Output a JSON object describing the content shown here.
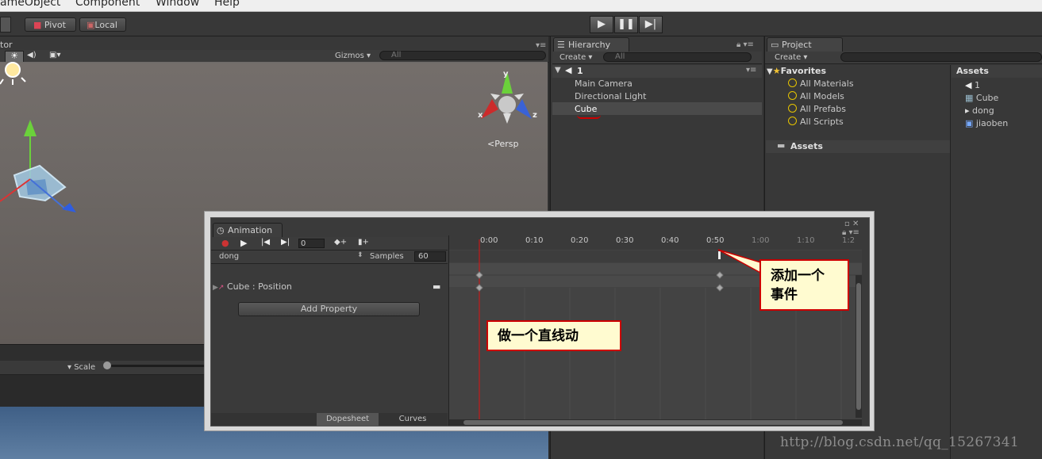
{
  "menu": {
    "items": [
      "ameObject",
      "Component",
      "Window",
      "Help"
    ]
  },
  "toolbar": {
    "pivot_label": "Pivot",
    "local_label": "Local",
    "play_icon": "play-icon",
    "pause_icon": "pause-icon",
    "step_icon": "step-icon"
  },
  "scene": {
    "title_partial": "tor",
    "gizmos_label": "Gizmos",
    "search_placeholder": "All",
    "persp_label": "Persp",
    "axis": {
      "y": "y",
      "x": "x",
      "z": "z"
    },
    "scale_label": "Scale"
  },
  "hierarchy": {
    "tab": "Hierarchy",
    "create": "Create",
    "search_placeholder": "All",
    "scene_name": "1",
    "items": [
      "Main Camera",
      "Directional Light",
      "Cube"
    ],
    "selected": "Cube"
  },
  "project": {
    "tab": "Project",
    "create": "Create",
    "favorites": {
      "label": "Favorites",
      "items": [
        "All Materials",
        "All Models",
        "All Prefabs",
        "All Scripts"
      ]
    },
    "assets_folder": "Assets",
    "assets_header": "Assets",
    "assets": [
      "1",
      "Cube",
      "dong",
      "jiaoben"
    ]
  },
  "animation": {
    "tab": "Animation",
    "frame": "0",
    "clip": "dong",
    "samples_label": "Samples",
    "samples": "60",
    "property": "Cube : Position",
    "add_property": "Add Property",
    "timeline": [
      "0:00",
      "0:10",
      "0:20",
      "0:30",
      "0:40",
      "0:50",
      "1:00",
      "1:10",
      "1:2"
    ],
    "dopesheet": "Dopesheet",
    "curves": "Curves"
  },
  "callouts": {
    "event": "添加一个\n事件",
    "linear": "做一个直线动"
  },
  "watermark": "http://blog.csdn.net/qq_15267341",
  "colors": {
    "accent_red": "#cc0000",
    "callout_bg": "#fffbd0",
    "selection": "#4a4a4a"
  }
}
